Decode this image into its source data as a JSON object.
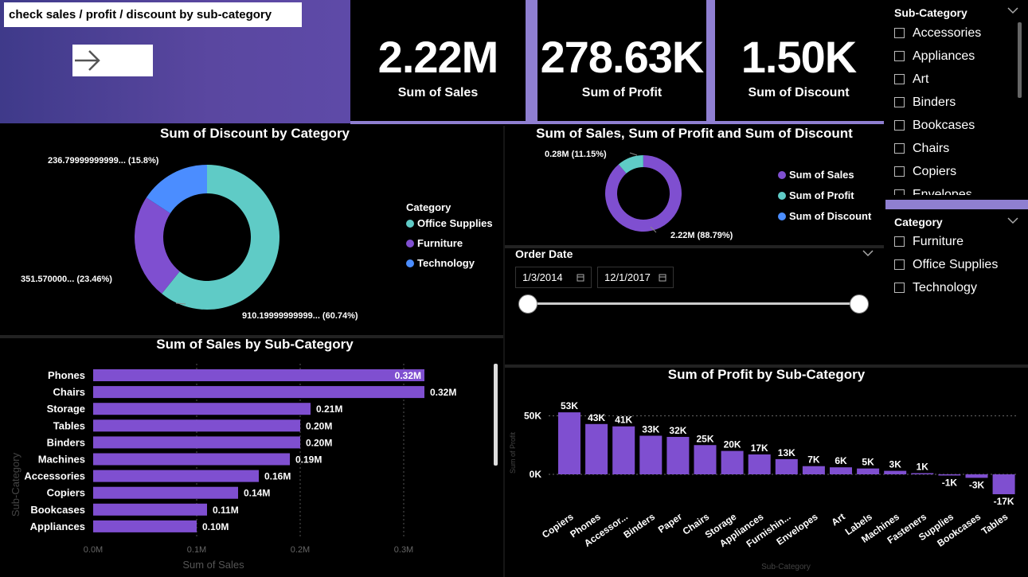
{
  "header": {
    "title": "check sales / profit / discount by sub-category"
  },
  "kpis": [
    {
      "value": "2.22M",
      "label": "Sum of Sales"
    },
    {
      "value": "278.63K",
      "label": "Sum of Profit"
    },
    {
      "value": "1.50K",
      "label": "Sum of Discount"
    }
  ],
  "colors": {
    "office_supplies": "#5fcbc6",
    "furniture": "#7f4fd0",
    "technology": "#4b8dff",
    "bar": "#7f4fd0",
    "banner": "#5a47a0"
  },
  "donut_discount": {
    "title": "Sum of Discount by Category",
    "legend_title": "Category",
    "legend": [
      "Office Supplies",
      "Furniture",
      "Technology"
    ],
    "labels": [
      "910.19999999999... (60.74%)",
      "351.570000... (23.46%)",
      "236.79999999999... (15.8%)"
    ]
  },
  "donut_overview": {
    "title": "Sum of Sales, Sum of Profit and Sum of Discount",
    "legend": [
      "Sum of Sales",
      "Sum of Profit",
      "Sum of Discount"
    ],
    "labels": [
      "0.28M (11.15%)",
      "2.22M (88.79%)"
    ]
  },
  "order_date": {
    "title": "Order Date",
    "start": "1/3/2014",
    "end": "12/1/2017"
  },
  "slicer_subcategory": {
    "title": "Sub-Category",
    "items": [
      "Accessories",
      "Appliances",
      "Art",
      "Binders",
      "Bookcases",
      "Chairs",
      "Copiers",
      "Envelopes"
    ]
  },
  "slicer_category": {
    "title": "Category",
    "items": [
      "Furniture",
      "Office Supplies",
      "Technology"
    ]
  },
  "sales_chart": {
    "title": "Sum of Sales by Sub-Category",
    "ylabel": "Sub-Category",
    "xlabel": "Sum of Sales",
    "ticks": [
      "0.0M",
      "0.1M",
      "0.2M",
      "0.3M"
    ]
  },
  "profit_chart": {
    "title": "Sum of Profit by Sub-Category",
    "ylabel": "Sum of Profit",
    "xlabel": "Sub-Category",
    "ticks": [
      "50K",
      "0K"
    ]
  },
  "chart_data": [
    {
      "type": "pie",
      "title": "Sum of Discount by Category",
      "categories": [
        "Office Supplies",
        "Furniture",
        "Technology"
      ],
      "values": [
        910.2,
        351.57,
        236.8
      ],
      "percents": [
        60.74,
        23.46,
        15.8
      ]
    },
    {
      "type": "pie",
      "title": "Sum of Sales, Sum of Profit and Sum of Discount",
      "categories": [
        "Sum of Sales",
        "Sum of Profit",
        "Sum of Discount"
      ],
      "values": [
        2.22,
        0.28,
        0.0015
      ],
      "percents": [
        88.79,
        11.15,
        0.06
      ]
    },
    {
      "type": "bar",
      "title": "Sum of Sales by Sub-Category",
      "categories": [
        "Phones",
        "Chairs",
        "Storage",
        "Tables",
        "Binders",
        "Machines",
        "Accessories",
        "Copiers",
        "Bookcases",
        "Appliances"
      ],
      "values": [
        0.32,
        0.32,
        0.21,
        0.2,
        0.2,
        0.19,
        0.16,
        0.14,
        0.11,
        0.1
      ],
      "labels": [
        "0.32M",
        "0.32M",
        "0.21M",
        "0.20M",
        "0.20M",
        "0.19M",
        "0.16M",
        "0.14M",
        "0.11M",
        "0.10M"
      ],
      "xlim": [
        0,
        0.35
      ]
    },
    {
      "type": "bar",
      "title": "Sum of Profit by Sub-Category",
      "categories": [
        "Copiers",
        "Phones",
        "Accessor...",
        "Binders",
        "Paper",
        "Chairs",
        "Storage",
        "Appliances",
        "Furnishin...",
        "Envelopes",
        "Art",
        "Labels",
        "Machines",
        "Fasteners",
        "Supplies",
        "Bookcases",
        "Tables"
      ],
      "values": [
        53,
        43,
        41,
        33,
        32,
        25,
        20,
        17,
        13,
        7,
        6,
        5,
        3,
        1,
        -1,
        -3,
        -17
      ],
      "labels": [
        "53K",
        "43K",
        "41K",
        "33K",
        "32K",
        "25K",
        "20K",
        "17K",
        "13K",
        "7K",
        "6K",
        "5K",
        "3K",
        "1K",
        "-1K",
        "-3K",
        "-17K"
      ],
      "ylim": [
        -20,
        60
      ]
    }
  ]
}
